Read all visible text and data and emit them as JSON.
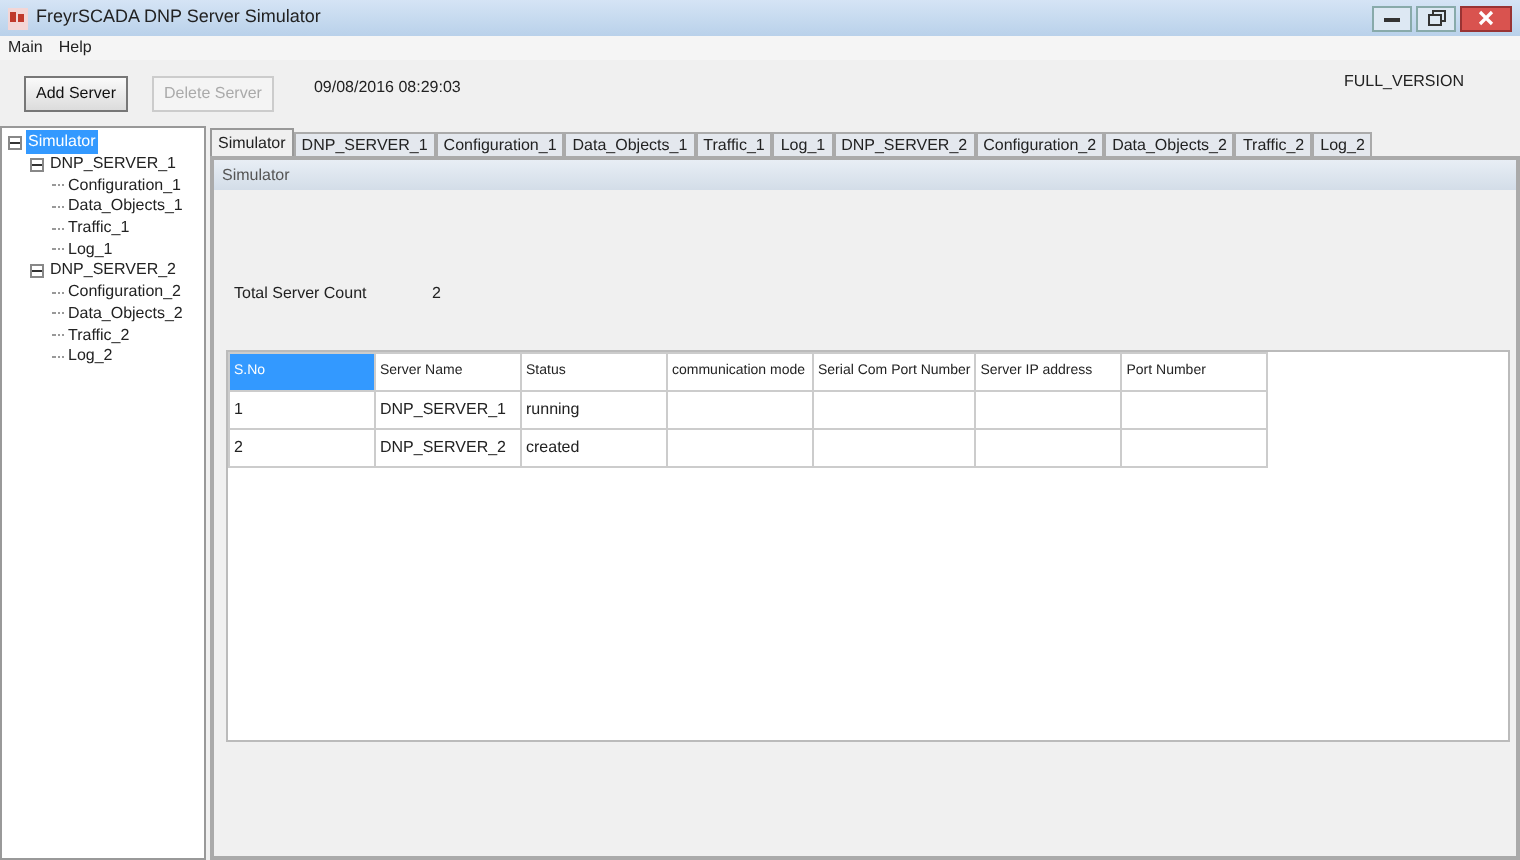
{
  "window": {
    "title": "FreyrSCADA DNP Server Simulator"
  },
  "menu": [
    "Main",
    "Help"
  ],
  "toolbar": {
    "buttons": [
      {
        "label": "Add Server",
        "disabled": false
      },
      {
        "label": "Delete Server",
        "disabled": true
      }
    ],
    "timestamp": "09/08/2016 08:29:03",
    "version": "FULL_VERSION"
  },
  "tree": [
    {
      "label": "Simulator",
      "selected": true,
      "expanded": true,
      "children": [
        {
          "label": "DNP_SERVER_1",
          "selected": false,
          "expanded": true,
          "children": [
            {
              "label": "Configuration_1",
              "selected": false
            },
            {
              "label": "Data_Objects_1",
              "selected": false
            },
            {
              "label": "Traffic_1",
              "selected": false
            },
            {
              "label": "Log_1",
              "selected": false
            }
          ]
        },
        {
          "label": "DNP_SERVER_2",
          "selected": false,
          "expanded": true,
          "children": [
            {
              "label": "Configuration_2",
              "selected": false
            },
            {
              "label": "Data_Objects_2",
              "selected": false
            },
            {
              "label": "Traffic_2",
              "selected": false
            },
            {
              "label": "Log_2",
              "selected": false
            }
          ]
        }
      ]
    }
  ],
  "tabs": [
    {
      "label": "Simulator",
      "selected": true
    },
    {
      "label": "DNP_SERVER_1",
      "selected": false
    },
    {
      "label": "Configuration_1",
      "selected": false
    },
    {
      "label": "Data_Objects_1",
      "selected": false
    },
    {
      "label": "Traffic_1",
      "selected": false
    },
    {
      "label": "Log_1",
      "selected": false
    },
    {
      "label": "DNP_SERVER_2",
      "selected": false
    },
    {
      "label": "Configuration_2",
      "selected": false
    },
    {
      "label": "Data_Objects_2",
      "selected": false
    },
    {
      "label": "Traffic_2",
      "selected": false
    },
    {
      "label": "Log_2",
      "selected": false
    }
  ],
  "panel": {
    "title": "Simulator",
    "count_label": "Total Server Count",
    "count_value": "2"
  },
  "table": {
    "columns": [
      {
        "label": "S.No",
        "selected": true
      },
      {
        "label": "Server Name",
        "selected": false
      },
      {
        "label": "Status",
        "selected": false
      },
      {
        "label": "communication mode",
        "selected": false
      },
      {
        "label": "Serial Com Port Number",
        "selected": false
      },
      {
        "label": "Server IP address",
        "selected": false
      },
      {
        "label": "Port Number",
        "selected": false
      }
    ],
    "rows": [
      [
        "1",
        "DNP_SERVER_1",
        "running"
      ],
      [
        "2",
        "DNP_SERVER_2",
        "created"
      ]
    ]
  }
}
